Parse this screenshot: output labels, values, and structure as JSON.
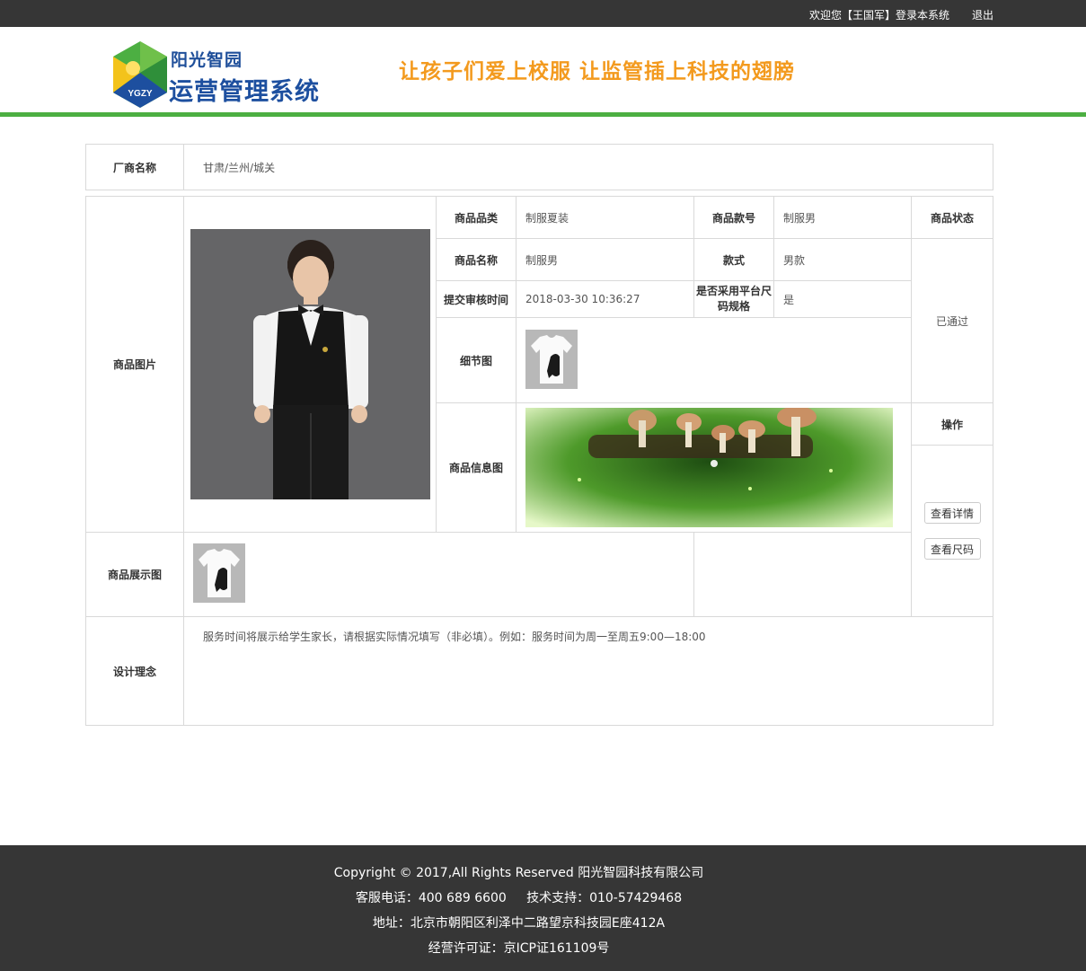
{
  "topbar": {
    "welcome": "欢迎您【王国军】登录本系统",
    "logout": "退出"
  },
  "header": {
    "logo_line1": "阳光智园",
    "logo_line2": "运营管理系统",
    "logo_badge": "YGZY",
    "slogan": "让孩子们爱上校服  让监管插上科技的翅膀"
  },
  "vendor": {
    "label": "厂商名称",
    "value": "甘肃/兰州/城关"
  },
  "product": {
    "image_label": "商品图片",
    "category_label": "商品品类",
    "category_value": "制服夏装",
    "style_no_label": "商品款号",
    "style_no_value": "制服男",
    "status_label": "商品状态",
    "status_value": "已通过",
    "name_label": "商品名称",
    "name_value": "制服男",
    "style_label": "款式",
    "style_value": "男款",
    "submit_time_label": "提交审核时间",
    "submit_time_value": "2018-03-30 10:36:27",
    "platform_size_label": "是否采用平台尺码规格",
    "platform_size_value": "是",
    "detail_label": "细节图",
    "info_label": "商品信息图",
    "operation_label": "操作",
    "display_label": "商品展示图",
    "view_detail": "查看详情",
    "view_size": "查看尺码"
  },
  "design": {
    "label": "设计理念",
    "value": "服务时间将展示给学生家长，请根据实际情况填写（非必填）。例如：服务时间为周一至周五9:00—18:00"
  },
  "footer": {
    "copyright": "Copyright © 2017,All Rights Reserved 阳光智园科技有限公司",
    "contact": "客服电话：400 689 6600     技术支持：010-57429468",
    "address": "地址：北京市朝阳区利泽中二路望京科技园E座412A",
    "license": "经营许可证：京ICP证161109号"
  },
  "colors": {
    "topbar_bg": "#363636",
    "header_rule": "#4caf42",
    "slogan": "#f39a1e",
    "logo_blue": "#1d4f9f"
  }
}
